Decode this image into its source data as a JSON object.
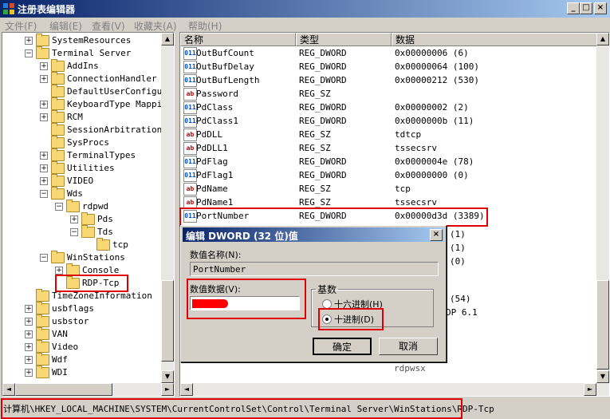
{
  "window": {
    "title": "注册表编辑器",
    "min": "_",
    "max": "□",
    "close": "×"
  },
  "menu": [
    "文件(F)",
    "编辑(E)",
    "查看(V)",
    "收藏夹(A)",
    "帮助(H)"
  ],
  "tree": [
    {
      "label": "SystemResources",
      "depth": 2,
      "exp": "+"
    },
    {
      "label": "Terminal Server",
      "depth": 2,
      "exp": "-"
    },
    {
      "label": "AddIns",
      "depth": 3,
      "exp": "+"
    },
    {
      "label": "ConnectionHandler",
      "depth": 3,
      "exp": "+"
    },
    {
      "label": "DefaultUserConfigur",
      "depth": 3,
      "exp": ""
    },
    {
      "label": "KeyboardType Mappin",
      "depth": 3,
      "exp": "+"
    },
    {
      "label": "RCM",
      "depth": 3,
      "exp": "+"
    },
    {
      "label": "SessionArbitrationH",
      "depth": 3,
      "exp": ""
    },
    {
      "label": "SysProcs",
      "depth": 3,
      "exp": ""
    },
    {
      "label": "TerminalTypes",
      "depth": 3,
      "exp": "+"
    },
    {
      "label": "Utilities",
      "depth": 3,
      "exp": "+"
    },
    {
      "label": "VIDEO",
      "depth": 3,
      "exp": "+"
    },
    {
      "label": "Wds",
      "depth": 3,
      "exp": "-"
    },
    {
      "label": "rdpwd",
      "depth": 4,
      "exp": "-"
    },
    {
      "label": "Pds",
      "depth": 5,
      "exp": "+"
    },
    {
      "label": "Tds",
      "depth": 5,
      "exp": "-"
    },
    {
      "label": "tcp",
      "depth": 6,
      "exp": ""
    },
    {
      "label": "WinStations",
      "depth": 3,
      "exp": "-"
    },
    {
      "label": "Console",
      "depth": 4,
      "exp": "+"
    },
    {
      "label": "RDP-Tcp",
      "depth": 4,
      "exp": ""
    },
    {
      "label": "TimeZoneInformation",
      "depth": 2,
      "exp": ""
    },
    {
      "label": "usbflags",
      "depth": 2,
      "exp": "+"
    },
    {
      "label": "usbstor",
      "depth": 2,
      "exp": "+"
    },
    {
      "label": "VAN",
      "depth": 2,
      "exp": "+"
    },
    {
      "label": "Video",
      "depth": 2,
      "exp": "+"
    },
    {
      "label": "Wdf",
      "depth": 2,
      "exp": "+"
    },
    {
      "label": "WDI",
      "depth": 2,
      "exp": "+"
    }
  ],
  "columns": [
    "名称",
    "类型",
    "数据"
  ],
  "rows": [
    {
      "name": "OutBufCount",
      "type": "REG_DWORD",
      "data": "0x00000006 (6)",
      "icon": "dword"
    },
    {
      "name": "OutBufDelay",
      "type": "REG_DWORD",
      "data": "0x00000064 (100)",
      "icon": "dword"
    },
    {
      "name": "OutBufLength",
      "type": "REG_DWORD",
      "data": "0x00000212 (530)",
      "icon": "dword"
    },
    {
      "name": "Password",
      "type": "REG_SZ",
      "data": "",
      "icon": "sz"
    },
    {
      "name": "PdClass",
      "type": "REG_DWORD",
      "data": "0x00000002 (2)",
      "icon": "dword"
    },
    {
      "name": "PdClass1",
      "type": "REG_DWORD",
      "data": "0x0000000b (11)",
      "icon": "dword"
    },
    {
      "name": "PdDLL",
      "type": "REG_SZ",
      "data": "tdtcp",
      "icon": "sz"
    },
    {
      "name": "PdDLL1",
      "type": "REG_SZ",
      "data": "tssecsrv",
      "icon": "sz"
    },
    {
      "name": "PdFlag",
      "type": "REG_DWORD",
      "data": "0x0000004e (78)",
      "icon": "dword"
    },
    {
      "name": "PdFlag1",
      "type": "REG_DWORD",
      "data": "0x00000000 (0)",
      "icon": "dword"
    },
    {
      "name": "PdName",
      "type": "REG_SZ",
      "data": "tcp",
      "icon": "sz"
    },
    {
      "name": "PdName1",
      "type": "REG_SZ",
      "data": "tssecsrv",
      "icon": "sz"
    },
    {
      "name": "PortNumber",
      "type": "REG_DWORD",
      "data": "0x00000d3d (3389)",
      "icon": "dword"
    }
  ],
  "behind_fragments": [
    "(1)",
    "(1)",
    "(0)",
    "(54)",
    "DP 6.1",
    "rdpwsx"
  ],
  "dialog": {
    "title": "编辑 DWORD (32 位)值",
    "close": "×",
    "name_label": "数值名称(N):",
    "name_value": "PortNumber",
    "data_label": "数值数据(V):",
    "base_label": "基数",
    "hex_label": "十六进制(H)",
    "dec_label": "十进制(D)",
    "ok": "确定",
    "cancel": "取消"
  },
  "status": "计算机\\HKEY_LOCAL_MACHINE\\SYSTEM\\CurrentControlSet\\Control\\Terminal Server\\WinStations\\RDP-Tcp"
}
